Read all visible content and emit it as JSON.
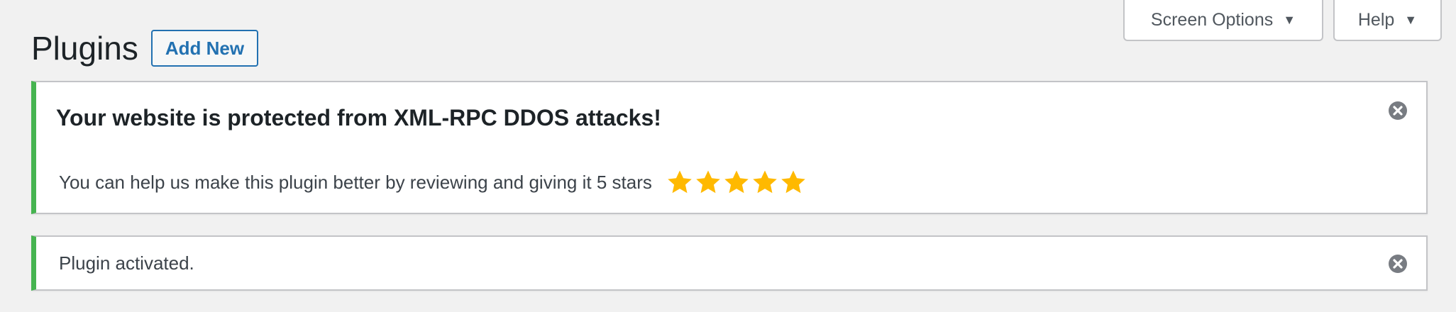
{
  "screen_meta": {
    "screen_options_label": "Screen Options",
    "help_label": "Help"
  },
  "header": {
    "title": "Plugins",
    "add_new_label": "Add New"
  },
  "notices": {
    "rpc": {
      "heading": "Your website is protected from XML-RPC DDOS attacks!",
      "text": "You can help us make this plugin better by reviewing and giving it 5 stars",
      "rating": 5,
      "rating_max": 5,
      "star_color": "#ffb900",
      "accent_color": "#46b450"
    },
    "activated": {
      "text": "Plugin activated.",
      "accent_color": "#46b450"
    }
  },
  "icons": {
    "dismiss": "dismiss-icon",
    "caret": "caret-down-icon",
    "star": "star-icon"
  }
}
